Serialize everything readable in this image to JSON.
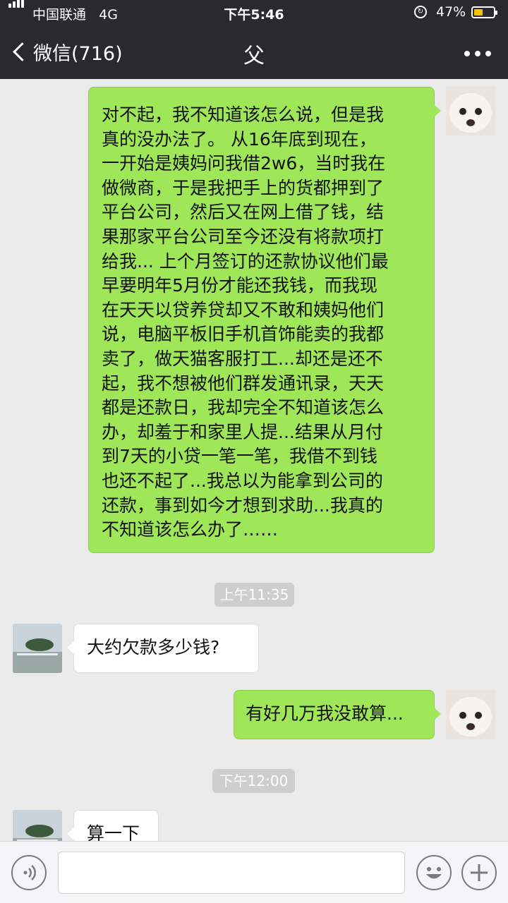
{
  "status_bar": {
    "carrier": "中国联通",
    "network": "4G",
    "time": "下午5:46",
    "battery": "47%",
    "battery_level": 0.47
  },
  "nav": {
    "back_label": "微信(716)",
    "title": "父"
  },
  "messages": [
    {
      "direction": "out",
      "lines": [
        "对不起，我不知道该怎么说，但是我",
        "真的没办法了。 从16年底到现在，",
        "一开始是姨妈问我借2w6，当时我在",
        "做微商，于是我把手上的货都押到了",
        "平台公司，然后又在网上借了钱，结",
        "果那家平台公司至今还没有将款项打",
        "给我... 上个月签订的还款协议他们最",
        "早要明年5月份才能还我钱，而我现",
        "在天天以贷养贷却又不敢和姨妈他们",
        "说，电脑平板旧手机首饰能卖的我都",
        "卖了，做天猫客服打工...却还是还不",
        "起，我不想被他们群发通讯录，天天",
        "都是还款日，我却完全不知道该怎么",
        "办，却羞于和家里人提...结果从月付",
        "到7天的小贷一笔一笔，我借不到钱",
        "也还不起了...我总以为能拿到公司的",
        "还款，事到如今才想到求助...我真的",
        "不知道该怎么办了……"
      ]
    },
    {
      "type": "timestamp",
      "text": "上午11:35"
    },
    {
      "direction": "in",
      "text": "大约欠款多少钱?"
    },
    {
      "direction": "out",
      "text": "有好几万我没敢算..."
    },
    {
      "type": "timestamp",
      "text": "下午12:00"
    },
    {
      "direction": "in",
      "text": "算一下"
    }
  ],
  "icons": {
    "voice": "voice-icon",
    "emoji": "emoji-icon",
    "plus": "plus-icon",
    "more": "more-icon",
    "back": "chevron-left-icon"
  }
}
